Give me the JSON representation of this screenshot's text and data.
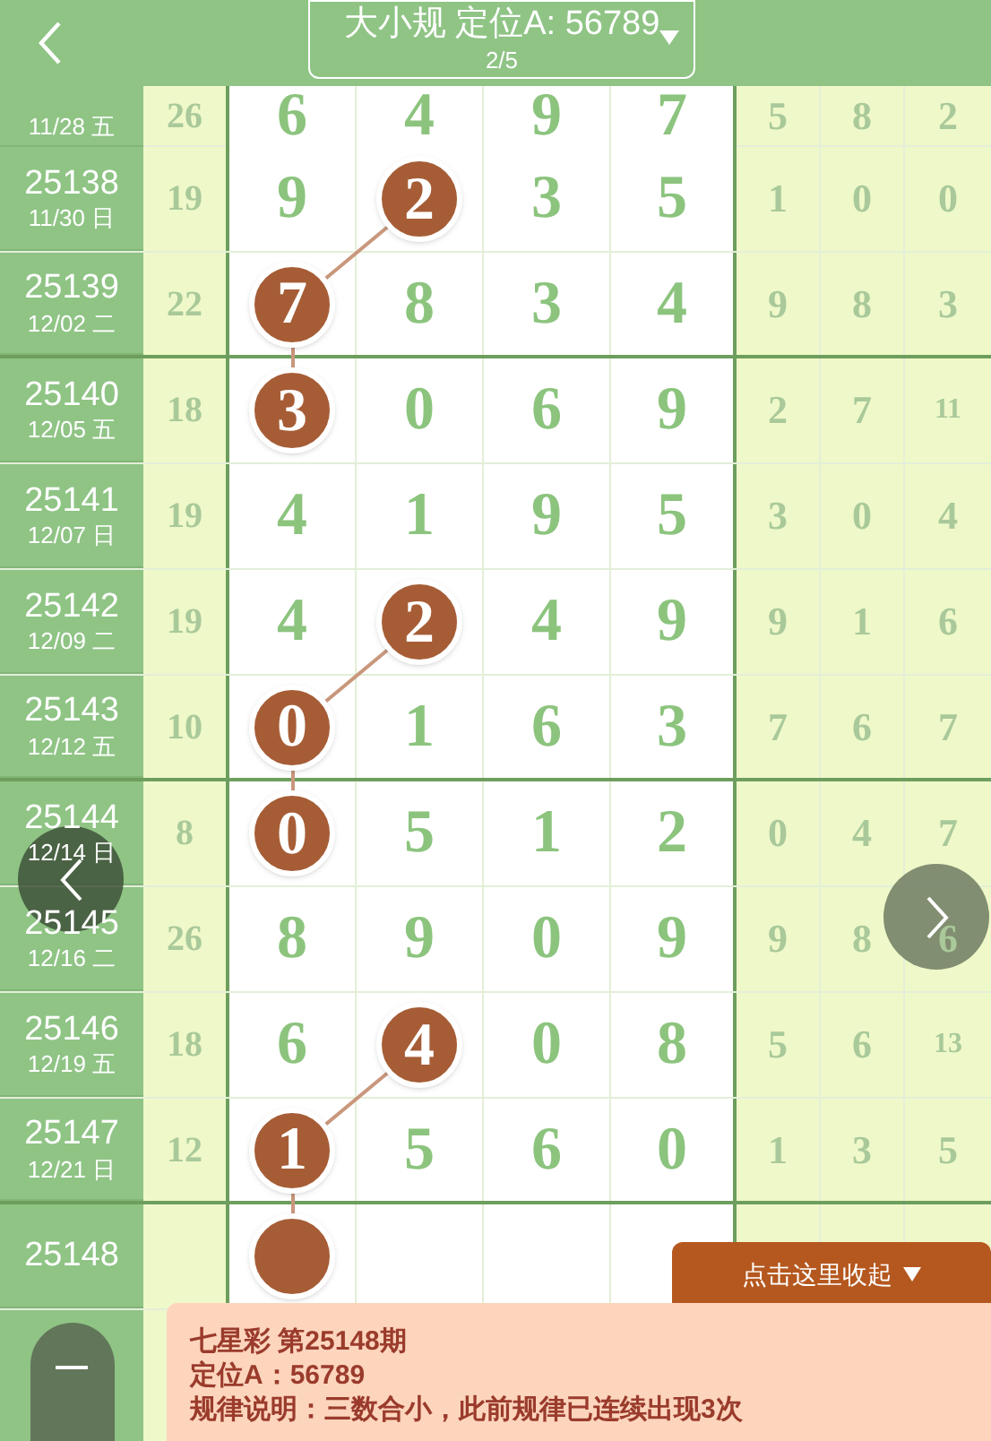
{
  "header": {
    "title": "大小规 定位A: 56789",
    "page": "2/5"
  },
  "rows": [
    {
      "date": "11/28 五",
      "sum": "26",
      "main": [
        {
          "value": "6",
          "hit": false
        },
        {
          "value": "4",
          "hit": false
        },
        {
          "value": "9",
          "hit": false
        },
        {
          "value": "7",
          "hit": false
        }
      ],
      "tail": [
        "5",
        "8",
        "2"
      ]
    },
    {
      "issue": "25138",
      "date": "11/30 日",
      "sum": "19",
      "main": [
        {
          "value": "9",
          "hit": false
        },
        {
          "value": "2",
          "hit": true
        },
        {
          "value": "3",
          "hit": false
        },
        {
          "value": "5",
          "hit": false
        }
      ],
      "tail": [
        "1",
        "0",
        "0"
      ]
    },
    {
      "issue": "25139",
      "date": "12/02 二",
      "sum": "22",
      "main": [
        {
          "value": "7",
          "hit": true
        },
        {
          "value": "8",
          "hit": false
        },
        {
          "value": "3",
          "hit": false
        },
        {
          "value": "4",
          "hit": false
        }
      ],
      "tail": [
        "9",
        "8",
        "3"
      ]
    },
    {
      "issue": "25140",
      "date": "12/05 五",
      "sum": "18",
      "main": [
        {
          "value": "3",
          "hit": true
        },
        {
          "value": "0",
          "hit": false
        },
        {
          "value": "6",
          "hit": false
        },
        {
          "value": "9",
          "hit": false
        }
      ],
      "tail": [
        "2",
        "7",
        "11"
      ]
    },
    {
      "issue": "25141",
      "date": "12/07 日",
      "sum": "19",
      "main": [
        {
          "value": "4",
          "hit": false
        },
        {
          "value": "1",
          "hit": false
        },
        {
          "value": "9",
          "hit": false
        },
        {
          "value": "5",
          "hit": false
        }
      ],
      "tail": [
        "3",
        "0",
        "4"
      ]
    },
    {
      "issue": "25142",
      "date": "12/09 二",
      "sum": "19",
      "main": [
        {
          "value": "4",
          "hit": false
        },
        {
          "value": "2",
          "hit": true
        },
        {
          "value": "4",
          "hit": false
        },
        {
          "value": "9",
          "hit": false
        }
      ],
      "tail": [
        "9",
        "1",
        "6"
      ]
    },
    {
      "issue": "25143",
      "date": "12/12 五",
      "sum": "10",
      "main": [
        {
          "value": "0",
          "hit": true
        },
        {
          "value": "1",
          "hit": false
        },
        {
          "value": "6",
          "hit": false
        },
        {
          "value": "3",
          "hit": false
        }
      ],
      "tail": [
        "7",
        "6",
        "7"
      ]
    },
    {
      "issue": "25144",
      "date": "12/14 日",
      "sum": "8",
      "main": [
        {
          "value": "0",
          "hit": true
        },
        {
          "value": "5",
          "hit": false
        },
        {
          "value": "1",
          "hit": false
        },
        {
          "value": "2",
          "hit": false
        }
      ],
      "tail": [
        "0",
        "4",
        "7"
      ]
    },
    {
      "issue": "25145",
      "date": "12/16 二",
      "sum": "26",
      "main": [
        {
          "value": "8",
          "hit": false
        },
        {
          "value": "9",
          "hit": false
        },
        {
          "value": "0",
          "hit": false
        },
        {
          "value": "9",
          "hit": false
        }
      ],
      "tail": [
        "9",
        "8",
        "6"
      ]
    },
    {
      "issue": "25146",
      "date": "12/19 五",
      "sum": "18",
      "main": [
        {
          "value": "6",
          "hit": false
        },
        {
          "value": "4",
          "hit": true
        },
        {
          "value": "0",
          "hit": false
        },
        {
          "value": "8",
          "hit": false
        }
      ],
      "tail": [
        "5",
        "6",
        "13"
      ]
    },
    {
      "issue": "25147",
      "date": "12/21 日",
      "sum": "12",
      "main": [
        {
          "value": "1",
          "hit": true
        },
        {
          "value": "5",
          "hit": false
        },
        {
          "value": "6",
          "hit": false
        },
        {
          "value": "0",
          "hit": false
        }
      ],
      "tail": [
        "1",
        "3",
        "5"
      ]
    },
    {
      "issue": "25148",
      "main": [
        {
          "hit": true
        },
        {
          "hit": false
        },
        {
          "hit": false
        },
        {
          "hit": false
        }
      ]
    }
  ],
  "collapse_button": "点击这里收起",
  "info": [
    "七星彩 第25148期",
    "定位A：56789",
    "规律说明：三数合小，此前规律已连续出现3次"
  ]
}
